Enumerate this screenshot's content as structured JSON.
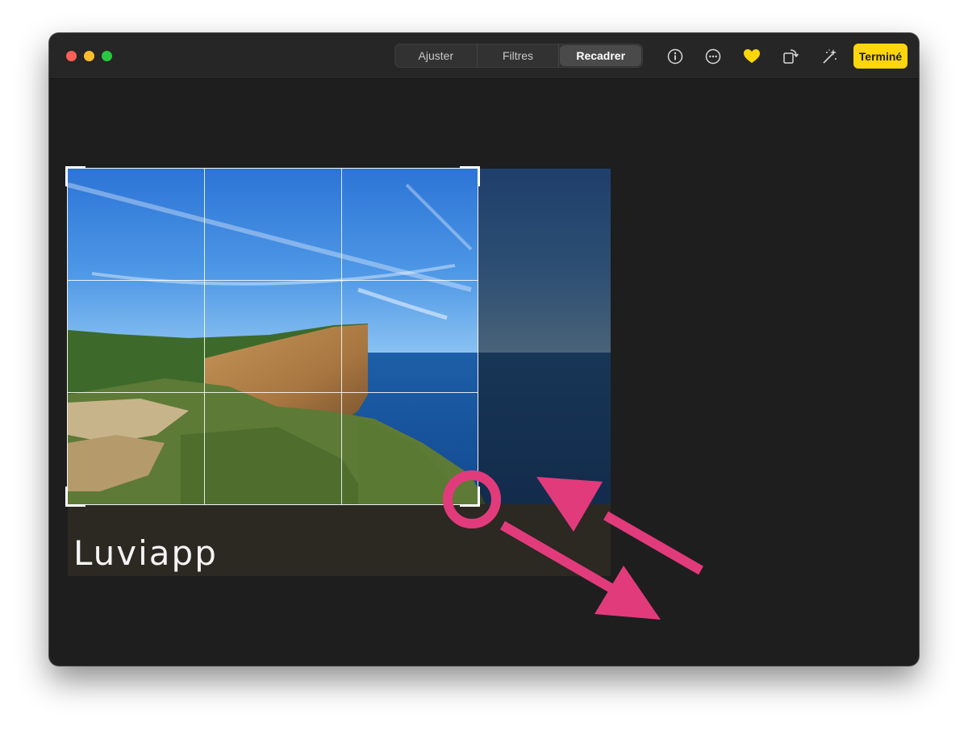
{
  "window": {
    "traffic_lights": [
      "close",
      "minimize",
      "zoom"
    ]
  },
  "toolbar": {
    "tabs": [
      {
        "label": "Ajuster",
        "active": false
      },
      {
        "label": "Filtres",
        "active": false
      },
      {
        "label": "Recadrer",
        "active": true
      }
    ],
    "icons": [
      "info-icon",
      "more-icon",
      "favorite-heart-icon",
      "rotate-icon",
      "auto-enhance-icon"
    ],
    "done_label": "Terminé",
    "done_color": "#ffd60a",
    "favorite_color": "#ffd60a"
  },
  "editor": {
    "photo_description_alt": "Falaise au bord de la mer",
    "watermark": "Luviapp",
    "annotation_color": "#e23b7c"
  }
}
